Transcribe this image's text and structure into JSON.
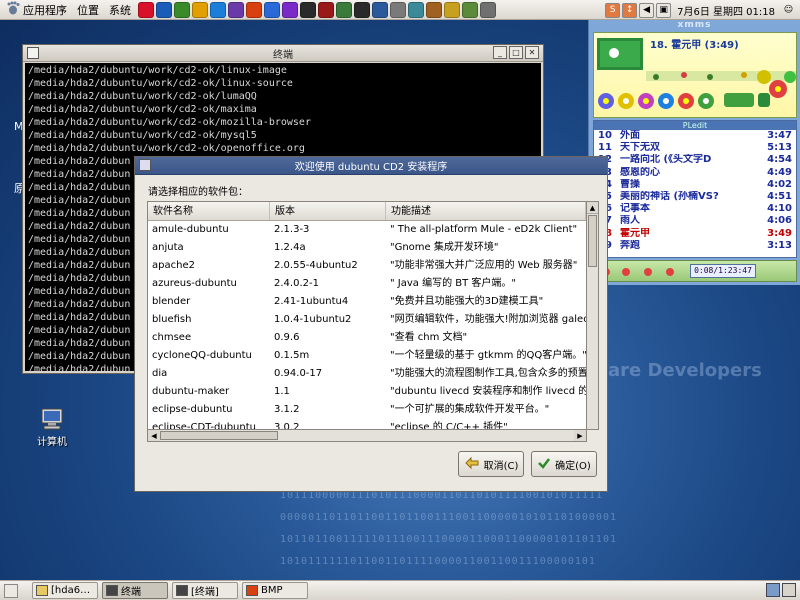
{
  "top_panel": {
    "applications": "应用程序",
    "places": "位置",
    "system": "系统",
    "launcher_colors": [
      "#d8102a",
      "#1a5cb8",
      "#3a8a2a",
      "#e2a000",
      "#1b7ed8",
      "#6a3aa8",
      "#d84010",
      "#2a6ad8",
      "#7a2ac8",
      "#2a2a2a",
      "#9a1a1a",
      "#3a7a3a",
      "#2a2a2a",
      "#2a5a9a",
      "#7a7a7a",
      "#3a8a9a",
      "#a06020",
      "#c8a020",
      "#5a8a3a",
      "#707070"
    ],
    "clock": "7月6日 星期四 01:18"
  },
  "terminal": {
    "title": "终端",
    "lines": [
      "/media/hda2/dubuntu/work/cd2-ok/linux-image",
      "/media/hda2/dubuntu/work/cd2-ok/linux-source",
      "/media/hda2/dubuntu/work/cd2-ok/lumaQQ",
      "/media/hda2/dubuntu/work/cd2-ok/maxima",
      "/media/hda2/dubuntu/work/cd2-ok/mozilla-browser",
      "/media/hda2/dubuntu/work/cd2-ok/mysql5",
      "/media/hda2/dubuntu/work/cd2-ok/openoffice.org",
      "/media/hda2/dubun",
      "/media/hda2/dubun",
      "/media/hda2/dubun",
      "/media/hda2/dubun",
      "/media/hda2/dubun",
      "/media/hda2/dubun",
      "/media/hda2/dubun",
      "/media/hda2/dubun",
      "/media/hda2/dubun",
      "/media/hda2/dubun",
      "/media/hda2/dubun",
      "/media/hda2/dubun",
      "/media/hda2/dubun",
      "/media/hda2/dubun",
      "/media/hda2/dubun",
      "/media/hda2/dubun",
      "/media/hda2/dubun"
    ]
  },
  "desktop": {
    "icon_label": "计算机",
    "watermark": "are Developers",
    "side_char_1": "M",
    "side_char_2": "原"
  },
  "music": {
    "header": "xmms",
    "now_playing": "18. 霍元甲 (3:49)",
    "time_display": "0:08/1:23:47",
    "playlist_header": "PLedit",
    "playlist": [
      {
        "num": "10",
        "title": "外面",
        "time": "3:47",
        "current": false
      },
      {
        "num": "11",
        "title": "天下无双",
        "time": "5:13",
        "current": false
      },
      {
        "num": "12",
        "title": "一路向北 (《头文字D",
        "time": "4:54",
        "current": false
      },
      {
        "num": "13",
        "title": "感恩的心",
        "time": "4:49",
        "current": false
      },
      {
        "num": "14",
        "title": "曹操",
        "time": "4:02",
        "current": false
      },
      {
        "num": "15",
        "title": "美丽的神话 (孙楠VS?",
        "time": "4:51",
        "current": false
      },
      {
        "num": "16",
        "title": "记事本",
        "time": "4:10",
        "current": false
      },
      {
        "num": "17",
        "title": "雨人",
        "time": "4:06",
        "current": false
      },
      {
        "num": "18",
        "title": "霍元甲",
        "time": "3:49",
        "current": true
      },
      {
        "num": "19",
        "title": "奔跑",
        "time": "3:13",
        "current": false
      }
    ]
  },
  "installer": {
    "title": "欢迎使用 dubuntu CD2 安装程序",
    "prompt": "请选择相应的软件包：",
    "columns": [
      "软件名称",
      "版本",
      "功能描述"
    ],
    "rows": [
      [
        "amule-dubuntu",
        "2.1.3-3",
        "\" The all-platform Mule - eD2k Client\""
      ],
      [
        "anjuta",
        "1.2.4a",
        "\"Gnome 集成开发环境\""
      ],
      [
        "apache2",
        "2.0.55-4ubuntu2",
        "\"功能非常强大并广泛应用的 Web 服务器\""
      ],
      [
        "azureus-dubuntu",
        "2.4.0.2-1",
        "\" Java 编写的 BT 客户端。\""
      ],
      [
        "blender",
        "2.41-1ubuntu4",
        "\"免费并且功能强大的3D建模工具\""
      ],
      [
        "bluefish",
        "1.0.4-1ubuntu2",
        "\"网页编辑软件，功能强大!附加浏览器 galeon\""
      ],
      [
        "chmsee",
        "0.9.6",
        "\"查看 chm 文档\""
      ],
      [
        "cycloneQQ-dubuntu",
        "0.1.5m",
        "\"一个轻量级的基于 gtkmm 的QQ客户端。\""
      ],
      [
        "dia",
        "0.94.0-17",
        "\"功能强大的流程图制作工具,包含众多的预置图\""
      ],
      [
        "dubuntu-maker",
        "1.1",
        "\"dubuntu livecd 安装程序和制作 livecd 的脚\""
      ],
      [
        "eclipse-dubuntu",
        "3.1.2",
        "\"一个可扩展的集成软件开发平台。\""
      ],
      [
        "eclipse-CDT-dubuntu",
        "3.0.2",
        "\"eclipse 的 C/C++ 插件\""
      ]
    ],
    "cancel": "取消(C)",
    "ok": "确定(O)"
  },
  "taskbar": [
    {
      "label": "[hda6…",
      "active": false
    },
    {
      "label": "终端",
      "active": true
    },
    {
      "label": "[终端]",
      "active": false
    },
    {
      "label": "BMP",
      "active": false
    }
  ]
}
